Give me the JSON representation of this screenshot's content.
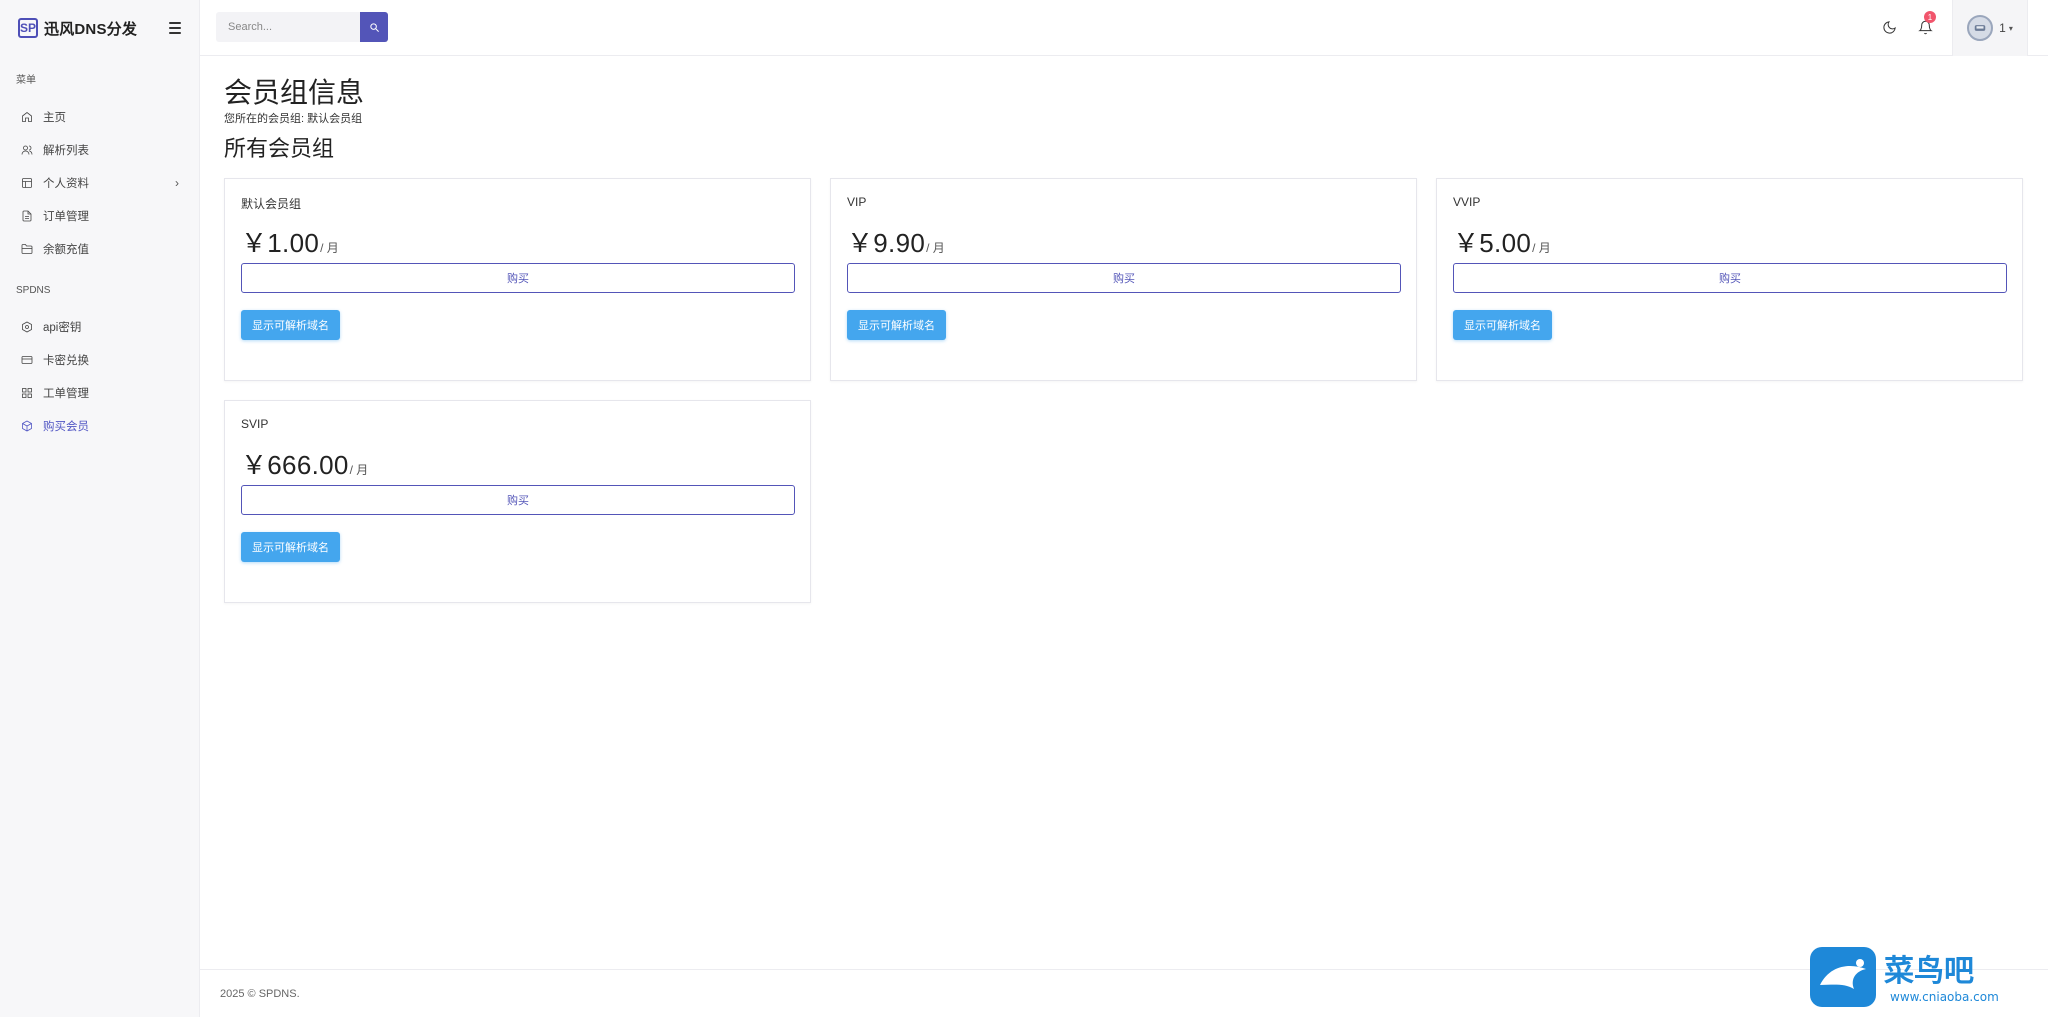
{
  "brand": {
    "logo_text": "SP",
    "name": "迅风DNS分发"
  },
  "sidebar": {
    "section1": "菜单",
    "items1": [
      {
        "label": "主页",
        "icon": "home-icon"
      },
      {
        "label": "解析列表",
        "icon": "users-icon"
      },
      {
        "label": "个人资料",
        "icon": "layout-icon"
      },
      {
        "label": "订单管理",
        "icon": "file-icon"
      },
      {
        "label": "余额充值",
        "icon": "folder-icon"
      }
    ],
    "section2": "SPDNS",
    "items2": [
      {
        "label": "api密钥",
        "icon": "hexagon-icon"
      },
      {
        "label": "卡密兑换",
        "icon": "credit-card-icon"
      },
      {
        "label": "工单管理",
        "icon": "grid-icon"
      },
      {
        "label": "购买会员",
        "icon": "package-icon"
      }
    ]
  },
  "search": {
    "placeholder": "Search..."
  },
  "topbar": {
    "notification_count": "1",
    "user_name": "1"
  },
  "page": {
    "title": "会员组信息",
    "current_group": "您所在的会员组: 默认会员组",
    "section_title": "所有会员组"
  },
  "plans": [
    {
      "name": "默认会员组",
      "price": "￥1.00",
      "unit": "/ 月",
      "buy_label": "购买",
      "domains_label": "显示可解析域名"
    },
    {
      "name": "VIP",
      "price": "￥9.90",
      "unit": "/ 月",
      "buy_label": "购买",
      "domains_label": "显示可解析域名"
    },
    {
      "name": "VVIP",
      "price": "￥5.00",
      "unit": "/ 月",
      "buy_label": "购买",
      "domains_label": "显示可解析域名"
    },
    {
      "name": "SVIP",
      "price": "￥666.00",
      "unit": "/ 月",
      "buy_label": "购买",
      "domains_label": "显示可解析域名"
    }
  ],
  "footer": {
    "text": "2025 © SPDNS."
  },
  "watermark": {
    "title": "菜鸟吧",
    "url": "www.cniaoba.com"
  },
  "colors": {
    "primary": "#5355b8",
    "info": "#44a6ee",
    "badge": "#f1556c"
  }
}
